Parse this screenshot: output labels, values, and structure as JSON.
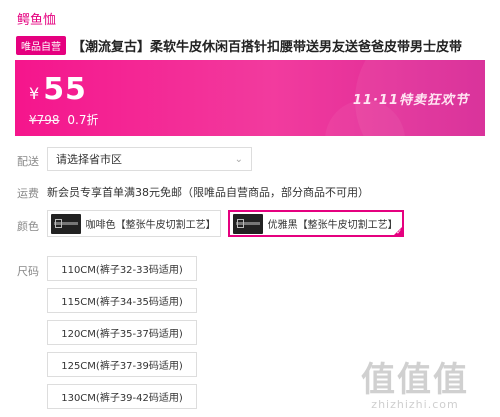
{
  "brand": {
    "name": "鳄鱼恤"
  },
  "product": {
    "badge": "唯品自营",
    "title": "【潮流复古】柔软牛皮休闲百搭针扣腰带送男友送爸爸皮带男士皮带"
  },
  "promo": {
    "currency": "¥",
    "price": "55",
    "original_price": "¥798",
    "discount": "0.7折",
    "festival": "11·11特卖狂欢节",
    "colors": {
      "start": "#f5158c",
      "end": "#d72795"
    }
  },
  "delivery": {
    "label": "配送",
    "placeholder": "请选择省市区"
  },
  "shipping": {
    "label": "运费",
    "text": "新会员专享首单满38元免邮（限唯品自营商品，部分商品不可用）"
  },
  "colors_section": {
    "label": "颜色",
    "options": [
      {
        "label": "咖啡色【整张牛皮切割工艺】",
        "selected": false
      },
      {
        "label": "优雅黑【整张牛皮切割工艺】",
        "selected": true
      }
    ]
  },
  "sizes_section": {
    "label": "尺码",
    "options": [
      "110CM(裤子32-33码适用)",
      "115CM(裤子34-35码适用)",
      "120CM(裤子35-37码适用)",
      "125CM(裤子37-39码适用)",
      "130CM(裤子39-42码适用)"
    ]
  },
  "watermark": {
    "icon": "值值值",
    "text": "zhizhizhi.com"
  },
  "theme": {
    "accent": "#e5007f"
  }
}
